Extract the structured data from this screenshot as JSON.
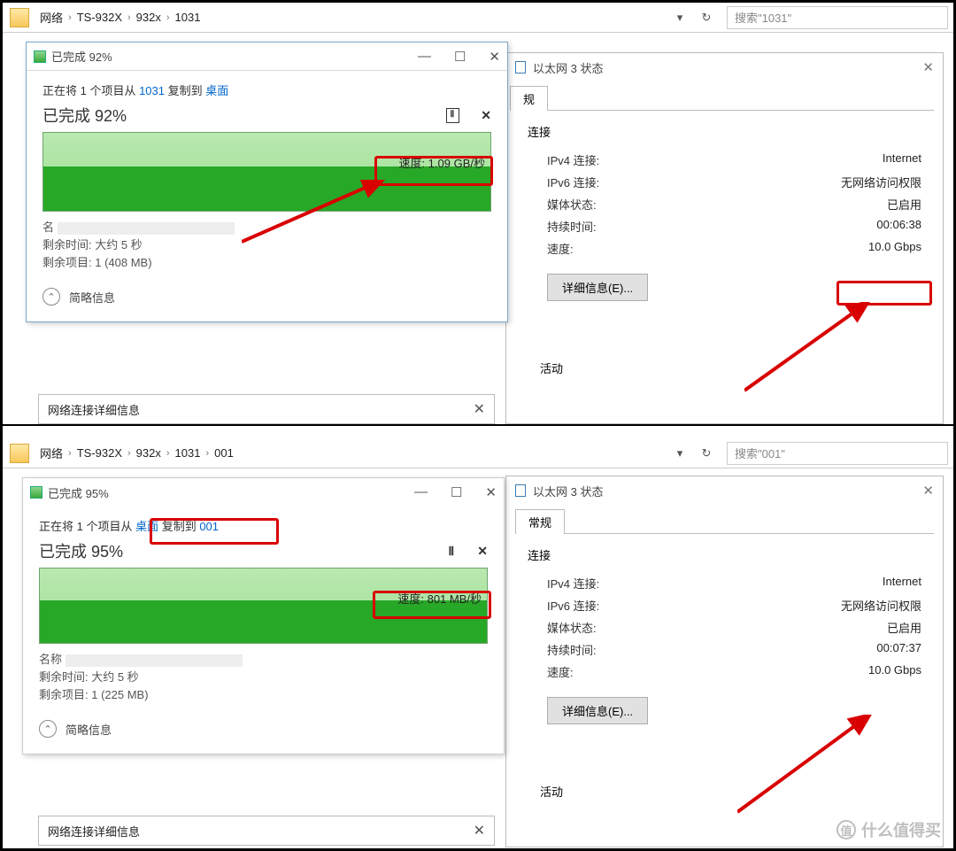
{
  "top": {
    "nav": {
      "segs": [
        "网络",
        "TS-932X",
        "932x",
        "1031"
      ],
      "search_ph": "搜索\"1031\""
    },
    "copy": {
      "title": "已完成 92%",
      "line_pre": "正在将 1 个项目从 ",
      "src": "1031",
      "mid": " 复制到 ",
      "dst": "桌面",
      "pct": "已完成 92%",
      "speed": "速度: 1.09 GB/秒",
      "name": "名",
      "remain_time": "剩余时间: 大约 5 秒",
      "remain_items": "剩余项目: 1 (408 MB)",
      "summary": "简略信息"
    },
    "eth": {
      "title": "以太网 3 状态",
      "tab": "规",
      "section": "连接",
      "rows": [
        {
          "k": "IPv4 连接:",
          "v": "Internet"
        },
        {
          "k": "IPv6 连接:",
          "v": "无网络访问权限"
        },
        {
          "k": "媒体状态:",
          "v": "已启用"
        },
        {
          "k": "持续时间:",
          "v": "00:06:38"
        },
        {
          "k": "速度:",
          "v": "10.0 Gbps"
        }
      ],
      "detail_btn": "详细信息(E)...",
      "activity": "活动"
    },
    "detail_bar": "网络连接详细信息"
  },
  "bottom": {
    "nav": {
      "segs": [
        "网络",
        "TS-932X",
        "932x",
        "1031",
        "001"
      ],
      "search_ph": "搜索\"001\""
    },
    "copy": {
      "title": "已完成 95%",
      "line_pre": "正在将 1 个项目从 ",
      "src": "桌面",
      "mid": " 复制到 ",
      "dst": "001",
      "pct": "已完成 95%",
      "speed": "速度: 801 MB/秒",
      "name": "名称",
      "remain_time": "剩余时间: 大约 5 秒",
      "remain_items": "剩余项目: 1 (225 MB)",
      "summary": "简略信息"
    },
    "eth": {
      "title": "以太网 3 状态",
      "tab": "常规",
      "section": "连接",
      "rows": [
        {
          "k": "IPv4 连接:",
          "v": "Internet"
        },
        {
          "k": "IPv6 连接:",
          "v": "无网络访问权限"
        },
        {
          "k": "媒体状态:",
          "v": "已启用"
        },
        {
          "k": "持续时间:",
          "v": "00:07:37"
        },
        {
          "k": "速度:",
          "v": "10.0 Gbps"
        }
      ],
      "detail_btn": "详细信息(E)...",
      "activity": "活动"
    },
    "detail_bar": "网络连接详细信息"
  },
  "watermark": "什么值得买"
}
